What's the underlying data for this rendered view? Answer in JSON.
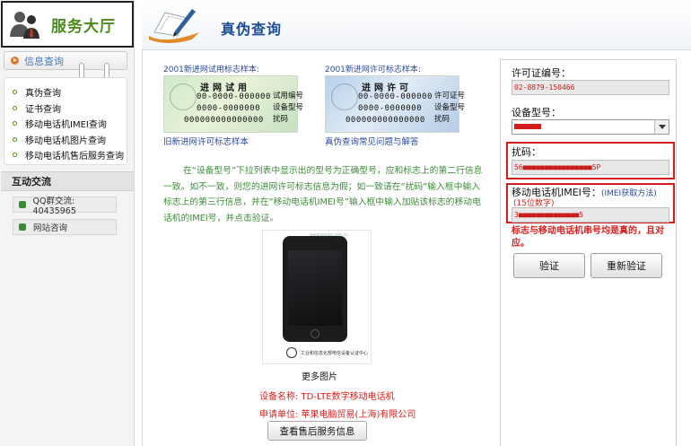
{
  "sidebar": {
    "title": "服务大厅",
    "menu_header": "信息查询",
    "items": [
      {
        "label": "真伪查询"
      },
      {
        "label": "证书查询"
      },
      {
        "label": "移动电话机IMEI查询"
      },
      {
        "label": "移动电话机图片查询"
      },
      {
        "label": "移动电话机售后服务查询"
      }
    ],
    "interact_header": "互动交流",
    "qq": "QQ群交流: 40435965",
    "consult": "网站咨询"
  },
  "header": {
    "title": "真伪查询"
  },
  "samples": {
    "trial": {
      "caption": "2001新进网试用标志样本:",
      "card_title": "进网试用",
      "line1": "00-0000-000000",
      "line2": "0000-0000000",
      "line3": "000000000000000",
      "anno1": "试用编号",
      "anno2": "设备型号",
      "anno3": "扰码",
      "link": "旧新进网许可标志样本"
    },
    "license": {
      "caption": "2001新进网许可标志样本:",
      "card_title": "进网许可",
      "line1": "00-0000-000000",
      "line2": "0000-0000000",
      "line3": "000000000000000",
      "anno1": "许可证号",
      "anno2": "设备型号",
      "anno3": "扰码",
      "link": "真伪查询常见问题与解答"
    }
  },
  "instructions": "在“设备型号”下拉列表中显示出的型号为正确型号，应和标志上的第二行信息一致。如不一致，则您的进网许可标志信息为假；如一致请在“扰码”输入框中输入标志上的第三行信息，并在“移动电话机IMEI号”输入框中输入加贴该标志的移动电话机的IMEI号，并点击验证。",
  "phone": {
    "watermark": "www.tenaa.com.cn",
    "stamp": "工业和信息化部电信设备认证中心",
    "more_pics": "更多图片",
    "device_name": "设备名称: TD-LTE数字移动电话机",
    "applicant": "申请单位: 苹果电脑贸易(上海)有限公司",
    "service_button": "查看售后服务信息"
  },
  "form": {
    "license_label": "许可证编号：",
    "license_value": "02-8879-150466",
    "model_label": "设备型号：",
    "scramble_label": "扰码：",
    "scramble_value": "56■■■■■■■■■■■■■■■■5P",
    "imei_label": "移动电话机IMEI号：",
    "imei_hint": "(IMEI获取方法)",
    "imei_digits": "(15位数字)",
    "imei_value": "3■■■■■■■■■■■■■■5",
    "warning": "标志与移动电话机串号均是真的，且对应。",
    "verify_button": "验证",
    "reverify_button": "重新验证"
  },
  "colors": {
    "accent_green": "#4c8a1c",
    "title_blue": "#1d4e92",
    "link_blue": "#2b4a9a",
    "alert_red": "#d81e1e"
  }
}
